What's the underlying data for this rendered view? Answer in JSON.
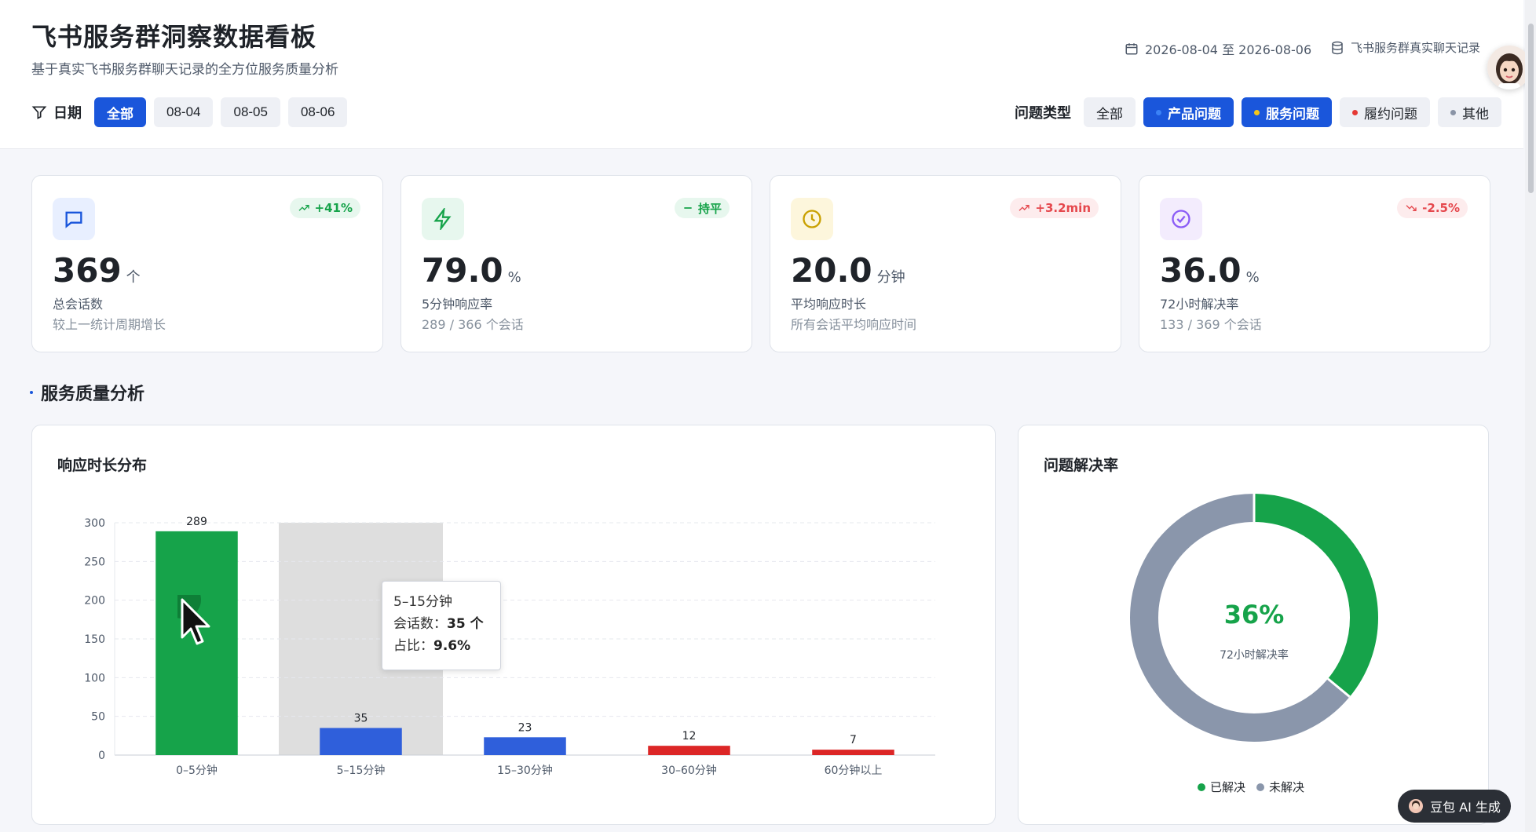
{
  "header": {
    "title": "飞书服务群洞察数据看板",
    "subtitle": "基于真实飞书服务群聊天记录的全方位服务质量分析",
    "date_range": "2026-08-04 至 2026-08-06",
    "source": "飞书服务群真实聊天记录"
  },
  "date_filter": {
    "label": "日期",
    "options": [
      "全部",
      "08-04",
      "08-05",
      "08-06"
    ],
    "selected": "全部"
  },
  "type_filter": {
    "label": "问题类型",
    "options": [
      {
        "label": "全部",
        "dot": "",
        "active": false
      },
      {
        "label": "产品问题",
        "dot": "#1a56db",
        "active": true
      },
      {
        "label": "服务问题",
        "dot": "#f5c518",
        "active": true
      },
      {
        "label": "履约问题",
        "dot": "#e53935",
        "active": false
      },
      {
        "label": "其他",
        "dot": "#8a94a6",
        "active": false
      }
    ]
  },
  "cards": [
    {
      "value": "369",
      "unit": "个",
      "label": "总会话数",
      "note": "较上一统计周期增长",
      "trend": "+41%",
      "trend_kind": "up-good",
      "icon": "chat-icon"
    },
    {
      "value": "79.0",
      "unit": "%",
      "label": "5分钟响应率",
      "note": "289 / 366 个会话",
      "trend": "持平",
      "trend_kind": "flat",
      "icon": "bolt-icon"
    },
    {
      "value": "20.0",
      "unit": "分钟",
      "label": "平均响应时长",
      "note": "所有会话平均响应时间",
      "trend": "+3.2min",
      "trend_kind": "up-bad",
      "icon": "clock-icon"
    },
    {
      "value": "36.0",
      "unit": "%",
      "label": "72小时解决率",
      "note": "133 / 369 个会话",
      "trend": "-2.5%",
      "trend_kind": "down-bad",
      "icon": "check-circle-icon"
    }
  ],
  "section": {
    "title": "服务质量分析"
  },
  "response_panel": {
    "title": "响应时长分布"
  },
  "resolution_panel": {
    "title": "问题解决率",
    "center_value": "36%",
    "center_label": "72小时解决率",
    "legend": [
      "已解决",
      "未解决"
    ]
  },
  "tooltip": {
    "title": "5–15分钟",
    "count_label": "会话数：",
    "count": "35 个",
    "ratio_label": "占比：",
    "ratio": "9.6%"
  },
  "chart_data": [
    {
      "type": "bar",
      "title": "响应时长分布",
      "categories": [
        "0–5分钟",
        "5–15分钟",
        "15–30分钟",
        "30–60分钟",
        "60分钟以上"
      ],
      "values": [
        289,
        35,
        23,
        12,
        7
      ],
      "colors": [
        "#16a34a",
        "#2f5fdb",
        "#2f5fdb",
        "#dc2626",
        "#dc2626"
      ],
      "ylim": [
        0,
        300
      ],
      "yticks": [
        0,
        50,
        100,
        150,
        200,
        250,
        300
      ],
      "grid": true,
      "highlight_index": 1
    },
    {
      "type": "pie",
      "title": "问题解决率",
      "labels": [
        "已解决",
        "未解决"
      ],
      "values": [
        36,
        64
      ],
      "colors": [
        "#16a34a",
        "#8a96ab"
      ]
    }
  ],
  "badge": {
    "label": "豆包 AI 生成"
  },
  "colors": {
    "accent": "#1a56db",
    "good": "#16a34a",
    "bad": "#e5484d"
  }
}
